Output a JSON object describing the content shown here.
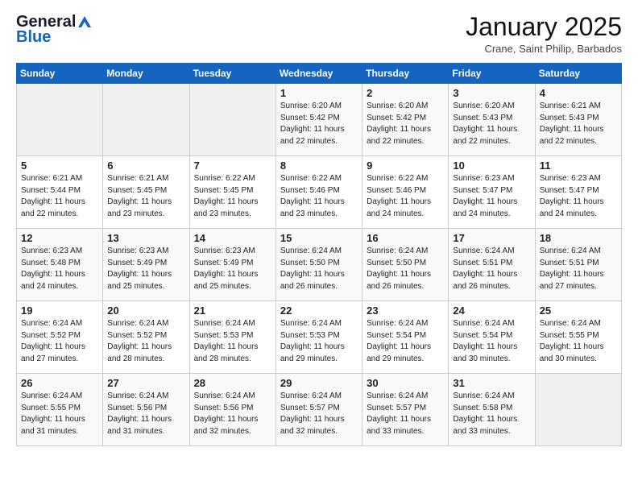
{
  "logo": {
    "general": "General",
    "blue": "Blue"
  },
  "title": "January 2025",
  "subtitle": "Crane, Saint Philip, Barbados",
  "days_of_week": [
    "Sunday",
    "Monday",
    "Tuesday",
    "Wednesday",
    "Thursday",
    "Friday",
    "Saturday"
  ],
  "weeks": [
    [
      {
        "day": "",
        "sunrise": "",
        "sunset": "",
        "daylight": ""
      },
      {
        "day": "",
        "sunrise": "",
        "sunset": "",
        "daylight": ""
      },
      {
        "day": "",
        "sunrise": "",
        "sunset": "",
        "daylight": ""
      },
      {
        "day": "1",
        "sunrise": "Sunrise: 6:20 AM",
        "sunset": "Sunset: 5:42 PM",
        "daylight": "Daylight: 11 hours and 22 minutes."
      },
      {
        "day": "2",
        "sunrise": "Sunrise: 6:20 AM",
        "sunset": "Sunset: 5:42 PM",
        "daylight": "Daylight: 11 hours and 22 minutes."
      },
      {
        "day": "3",
        "sunrise": "Sunrise: 6:20 AM",
        "sunset": "Sunset: 5:43 PM",
        "daylight": "Daylight: 11 hours and 22 minutes."
      },
      {
        "day": "4",
        "sunrise": "Sunrise: 6:21 AM",
        "sunset": "Sunset: 5:43 PM",
        "daylight": "Daylight: 11 hours and 22 minutes."
      }
    ],
    [
      {
        "day": "5",
        "sunrise": "Sunrise: 6:21 AM",
        "sunset": "Sunset: 5:44 PM",
        "daylight": "Daylight: 11 hours and 22 minutes."
      },
      {
        "day": "6",
        "sunrise": "Sunrise: 6:21 AM",
        "sunset": "Sunset: 5:45 PM",
        "daylight": "Daylight: 11 hours and 23 minutes."
      },
      {
        "day": "7",
        "sunrise": "Sunrise: 6:22 AM",
        "sunset": "Sunset: 5:45 PM",
        "daylight": "Daylight: 11 hours and 23 minutes."
      },
      {
        "day": "8",
        "sunrise": "Sunrise: 6:22 AM",
        "sunset": "Sunset: 5:46 PM",
        "daylight": "Daylight: 11 hours and 23 minutes."
      },
      {
        "day": "9",
        "sunrise": "Sunrise: 6:22 AM",
        "sunset": "Sunset: 5:46 PM",
        "daylight": "Daylight: 11 hours and 24 minutes."
      },
      {
        "day": "10",
        "sunrise": "Sunrise: 6:23 AM",
        "sunset": "Sunset: 5:47 PM",
        "daylight": "Daylight: 11 hours and 24 minutes."
      },
      {
        "day": "11",
        "sunrise": "Sunrise: 6:23 AM",
        "sunset": "Sunset: 5:47 PM",
        "daylight": "Daylight: 11 hours and 24 minutes."
      }
    ],
    [
      {
        "day": "12",
        "sunrise": "Sunrise: 6:23 AM",
        "sunset": "Sunset: 5:48 PM",
        "daylight": "Daylight: 11 hours and 24 minutes."
      },
      {
        "day": "13",
        "sunrise": "Sunrise: 6:23 AM",
        "sunset": "Sunset: 5:49 PM",
        "daylight": "Daylight: 11 hours and 25 minutes."
      },
      {
        "day": "14",
        "sunrise": "Sunrise: 6:23 AM",
        "sunset": "Sunset: 5:49 PM",
        "daylight": "Daylight: 11 hours and 25 minutes."
      },
      {
        "day": "15",
        "sunrise": "Sunrise: 6:24 AM",
        "sunset": "Sunset: 5:50 PM",
        "daylight": "Daylight: 11 hours and 26 minutes."
      },
      {
        "day": "16",
        "sunrise": "Sunrise: 6:24 AM",
        "sunset": "Sunset: 5:50 PM",
        "daylight": "Daylight: 11 hours and 26 minutes."
      },
      {
        "day": "17",
        "sunrise": "Sunrise: 6:24 AM",
        "sunset": "Sunset: 5:51 PM",
        "daylight": "Daylight: 11 hours and 26 minutes."
      },
      {
        "day": "18",
        "sunrise": "Sunrise: 6:24 AM",
        "sunset": "Sunset: 5:51 PM",
        "daylight": "Daylight: 11 hours and 27 minutes."
      }
    ],
    [
      {
        "day": "19",
        "sunrise": "Sunrise: 6:24 AM",
        "sunset": "Sunset: 5:52 PM",
        "daylight": "Daylight: 11 hours and 27 minutes."
      },
      {
        "day": "20",
        "sunrise": "Sunrise: 6:24 AM",
        "sunset": "Sunset: 5:52 PM",
        "daylight": "Daylight: 11 hours and 28 minutes."
      },
      {
        "day": "21",
        "sunrise": "Sunrise: 6:24 AM",
        "sunset": "Sunset: 5:53 PM",
        "daylight": "Daylight: 11 hours and 28 minutes."
      },
      {
        "day": "22",
        "sunrise": "Sunrise: 6:24 AM",
        "sunset": "Sunset: 5:53 PM",
        "daylight": "Daylight: 11 hours and 29 minutes."
      },
      {
        "day": "23",
        "sunrise": "Sunrise: 6:24 AM",
        "sunset": "Sunset: 5:54 PM",
        "daylight": "Daylight: 11 hours and 29 minutes."
      },
      {
        "day": "24",
        "sunrise": "Sunrise: 6:24 AM",
        "sunset": "Sunset: 5:54 PM",
        "daylight": "Daylight: 11 hours and 30 minutes."
      },
      {
        "day": "25",
        "sunrise": "Sunrise: 6:24 AM",
        "sunset": "Sunset: 5:55 PM",
        "daylight": "Daylight: 11 hours and 30 minutes."
      }
    ],
    [
      {
        "day": "26",
        "sunrise": "Sunrise: 6:24 AM",
        "sunset": "Sunset: 5:55 PM",
        "daylight": "Daylight: 11 hours and 31 minutes."
      },
      {
        "day": "27",
        "sunrise": "Sunrise: 6:24 AM",
        "sunset": "Sunset: 5:56 PM",
        "daylight": "Daylight: 11 hours and 31 minutes."
      },
      {
        "day": "28",
        "sunrise": "Sunrise: 6:24 AM",
        "sunset": "Sunset: 5:56 PM",
        "daylight": "Daylight: 11 hours and 32 minutes."
      },
      {
        "day": "29",
        "sunrise": "Sunrise: 6:24 AM",
        "sunset": "Sunset: 5:57 PM",
        "daylight": "Daylight: 11 hours and 32 minutes."
      },
      {
        "day": "30",
        "sunrise": "Sunrise: 6:24 AM",
        "sunset": "Sunset: 5:57 PM",
        "daylight": "Daylight: 11 hours and 33 minutes."
      },
      {
        "day": "31",
        "sunrise": "Sunrise: 6:24 AM",
        "sunset": "Sunset: 5:58 PM",
        "daylight": "Daylight: 11 hours and 33 minutes."
      },
      {
        "day": "",
        "sunrise": "",
        "sunset": "",
        "daylight": ""
      }
    ]
  ]
}
